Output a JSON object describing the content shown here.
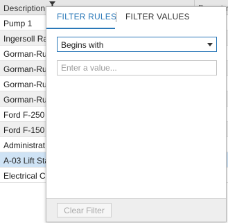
{
  "grid": {
    "columns": [
      "Description",
      "Departm"
    ],
    "rows": [
      "Pump 1",
      "Ingersoll Ra",
      "Gorman-Ru",
      "Gorman-Ru",
      "Gorman-Ru",
      "Gorman-Ru",
      "Ford F-250",
      "Ford F-150",
      "Administrat",
      "A-03 Lift Sta",
      "Electrical Co"
    ],
    "selected_row_index": 9,
    "filter_icon": "funnel-icon"
  },
  "filter_popup": {
    "tabs": [
      {
        "label": "FILTER RULES",
        "active": true
      },
      {
        "label": "FILTER VALUES",
        "active": false
      }
    ],
    "rule_select": {
      "selected": "Begins with",
      "arrow_icon": "chevron-down-icon"
    },
    "value_input": {
      "value": "",
      "placeholder": "Enter a value..."
    },
    "clear_button": {
      "label": "Clear Filter",
      "enabled": false
    }
  },
  "colors": {
    "accent": "#2a78b8",
    "selected_row": "#cfe3f5",
    "alt_row": "#efefef",
    "header_bg": "#e6e6e6"
  }
}
